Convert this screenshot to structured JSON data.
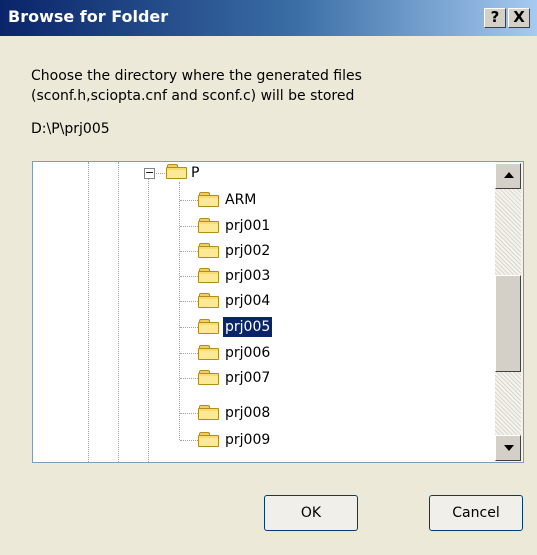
{
  "window": {
    "title": "Browse for Folder",
    "help_label": "?",
    "close_label": "X"
  },
  "message": {
    "line1": "Choose the directory where the generated files",
    "line2": "(sconf.h,sciopta.cnf and sconf.c) will be stored"
  },
  "current_path": "D:\\P\\prj005",
  "tree": {
    "parent": {
      "label": "P",
      "expander": "−",
      "icon": "folder-open-icon"
    },
    "children": [
      {
        "label": "ARM",
        "icon": "folder-icon"
      },
      {
        "label": "prj001",
        "icon": "folder-icon"
      },
      {
        "label": "prj002",
        "icon": "folder-icon"
      },
      {
        "label": "prj003",
        "icon": "folder-icon"
      },
      {
        "label": "prj004",
        "icon": "folder-icon"
      },
      {
        "label": "prj005",
        "icon": "folder-icon",
        "selected": true
      },
      {
        "label": "prj006",
        "icon": "folder-icon"
      },
      {
        "label": "prj007",
        "icon": "folder-icon"
      },
      {
        "label": "prj008",
        "icon": "folder-icon"
      },
      {
        "label": "prj009",
        "icon": "folder-icon"
      }
    ]
  },
  "buttons": {
    "ok": "OK",
    "cancel": "Cancel"
  },
  "colors": {
    "title_start": "#0a246a",
    "selection": "#0a246a",
    "dialog_bg": "#ece9d8",
    "folder": "#f7dd70"
  }
}
